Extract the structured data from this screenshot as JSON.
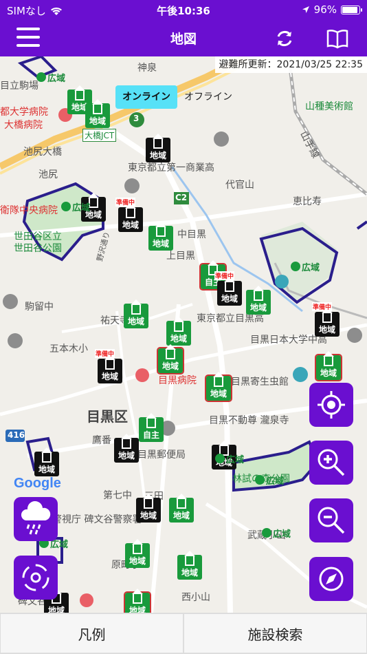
{
  "status": {
    "carrier": "SIMなし",
    "time": "午後10:36",
    "battery": "96%"
  },
  "nav": {
    "title": "地図"
  },
  "map": {
    "update_label": "避難所更新：2021/03/25 22:35",
    "mode": {
      "online": "オンライン",
      "offline": "オフライン"
    },
    "labels": [
      {
        "text": "神泉",
        "cls": ""
      },
      {
        "text": "目立駒場",
        "cls": ""
      },
      {
        "text": "山種美術館",
        "cls": "green"
      },
      {
        "text": "都大学病院",
        "cls": "red"
      },
      {
        "text": "大橋病院",
        "cls": "red"
      },
      {
        "text": "大橋JCT",
        "cls": "green"
      },
      {
        "text": "池尻大橋",
        "cls": ""
      },
      {
        "text": "東京都立第一商業高",
        "cls": ""
      },
      {
        "text": "代官山",
        "cls": ""
      },
      {
        "text": "恵比寿",
        "cls": ""
      },
      {
        "text": "衛隊中央病院",
        "cls": "red"
      },
      {
        "text": "世田谷区立",
        "cls": "green"
      },
      {
        "text": "世田谷公園",
        "cls": "green"
      },
      {
        "text": "中目黒",
        "cls": ""
      },
      {
        "text": "上目黒",
        "cls": ""
      },
      {
        "text": "駒留中",
        "cls": ""
      },
      {
        "text": "東京都立目黒高",
        "cls": ""
      },
      {
        "text": "目黒日本大学中高",
        "cls": ""
      },
      {
        "text": "五本木小",
        "cls": ""
      },
      {
        "text": "祐天寺",
        "cls": ""
      },
      {
        "text": "目黒病院",
        "cls": "red"
      },
      {
        "text": "目黒寄生虫館",
        "cls": ""
      },
      {
        "text": "目黒区",
        "cls": "big"
      },
      {
        "text": "目黒不動尊 瀧泉寺",
        "cls": ""
      },
      {
        "text": "鷹番",
        "cls": ""
      },
      {
        "text": "目黒郵便局",
        "cls": ""
      },
      {
        "text": "林試の森公園",
        "cls": "green"
      },
      {
        "text": "第七中",
        "cls": ""
      },
      {
        "text": "警視庁 碑文谷警察署",
        "cls": ""
      },
      {
        "text": "武蔵小山",
        "cls": ""
      },
      {
        "text": "原町小",
        "cls": ""
      },
      {
        "text": "西小山",
        "cls": ""
      },
      {
        "text": "碑文谷",
        "cls": ""
      },
      {
        "text": "山手線",
        "cls": ""
      },
      {
        "text": "野沢通り",
        "cls": ""
      },
      {
        "text": "池尻",
        "cls": ""
      },
      {
        "text": "三田",
        "cls": ""
      }
    ],
    "marker_labels": {
      "local": "地域",
      "wide": "広域",
      "self": "自主",
      "preparing": "準備中"
    },
    "google": "Google",
    "route_badges": [
      "3",
      "C2",
      "416"
    ]
  },
  "bottom": {
    "legend": "凡例",
    "facility_search": "施設検索"
  },
  "colors": {
    "brand": "#6a0fd0",
    "marker_green": "#199a3c",
    "marker_black": "#111111",
    "online_active": "#57e1f7"
  }
}
